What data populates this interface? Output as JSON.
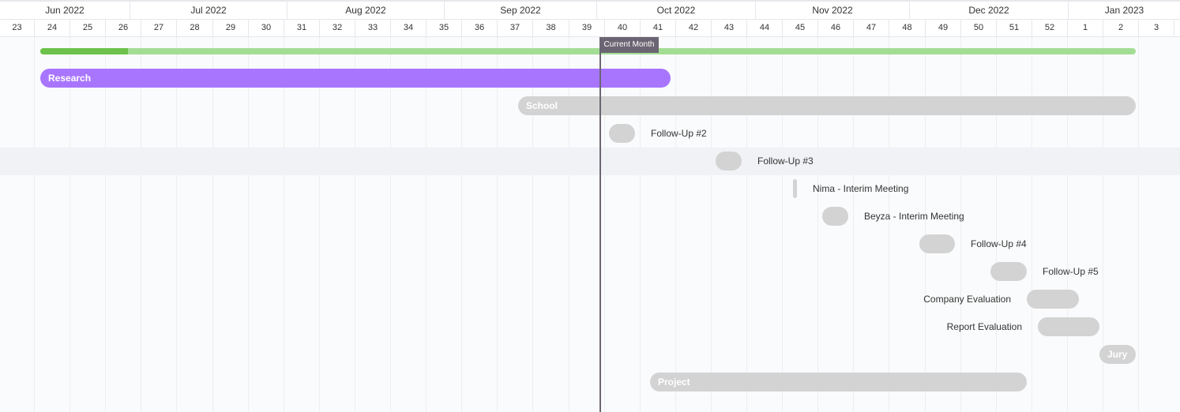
{
  "timeline": {
    "months": [
      "Jun 2022",
      "Jul 2022",
      "Aug 2022",
      "Sep 2022",
      "Oct 2022",
      "Nov 2022",
      "Dec 2022",
      "Jan 2023"
    ],
    "weeks": [
      "23",
      "24",
      "25",
      "26",
      "27",
      "28",
      "29",
      "30",
      "31",
      "32",
      "33",
      "34",
      "35",
      "36",
      "37",
      "38",
      "39",
      "40",
      "41",
      "42",
      "43",
      "44",
      "45",
      "46",
      "47",
      "48",
      "49",
      "50",
      "51",
      "52",
      "1",
      "2",
      "3"
    ],
    "current_marker": "Current Month"
  },
  "progress": {
    "fraction": 0.08
  },
  "tasks": [
    {
      "name": "Research",
      "color": "#a875ff"
    },
    {
      "name": "School",
      "color": "#d3d3d3"
    },
    {
      "name": "Follow-Up #2",
      "color": "#d3d3d3"
    },
    {
      "name": "Follow-Up #3",
      "color": "#d3d3d3"
    },
    {
      "name": "Nima - Interim Meeting",
      "color": "#d3d3d3"
    },
    {
      "name": "Beyza - Interim Meeting",
      "color": "#d3d3d3"
    },
    {
      "name": "Follow-Up #4",
      "color": "#d3d3d3"
    },
    {
      "name": "Follow-Up #5",
      "color": "#d3d3d3"
    },
    {
      "name": "Company Evaluation",
      "color": "#d3d3d3"
    },
    {
      "name": "Report Evaluation",
      "color": "#d3d3d3"
    },
    {
      "name": "Jury",
      "color": "#d3d3d3"
    },
    {
      "name": "Project",
      "color": "#d3d3d3"
    }
  ],
  "colors": {
    "progress_track": "#a3dd94",
    "progress_fill": "#6cc24a",
    "today_line": "#6b6573",
    "accent": "#a875ff"
  }
}
